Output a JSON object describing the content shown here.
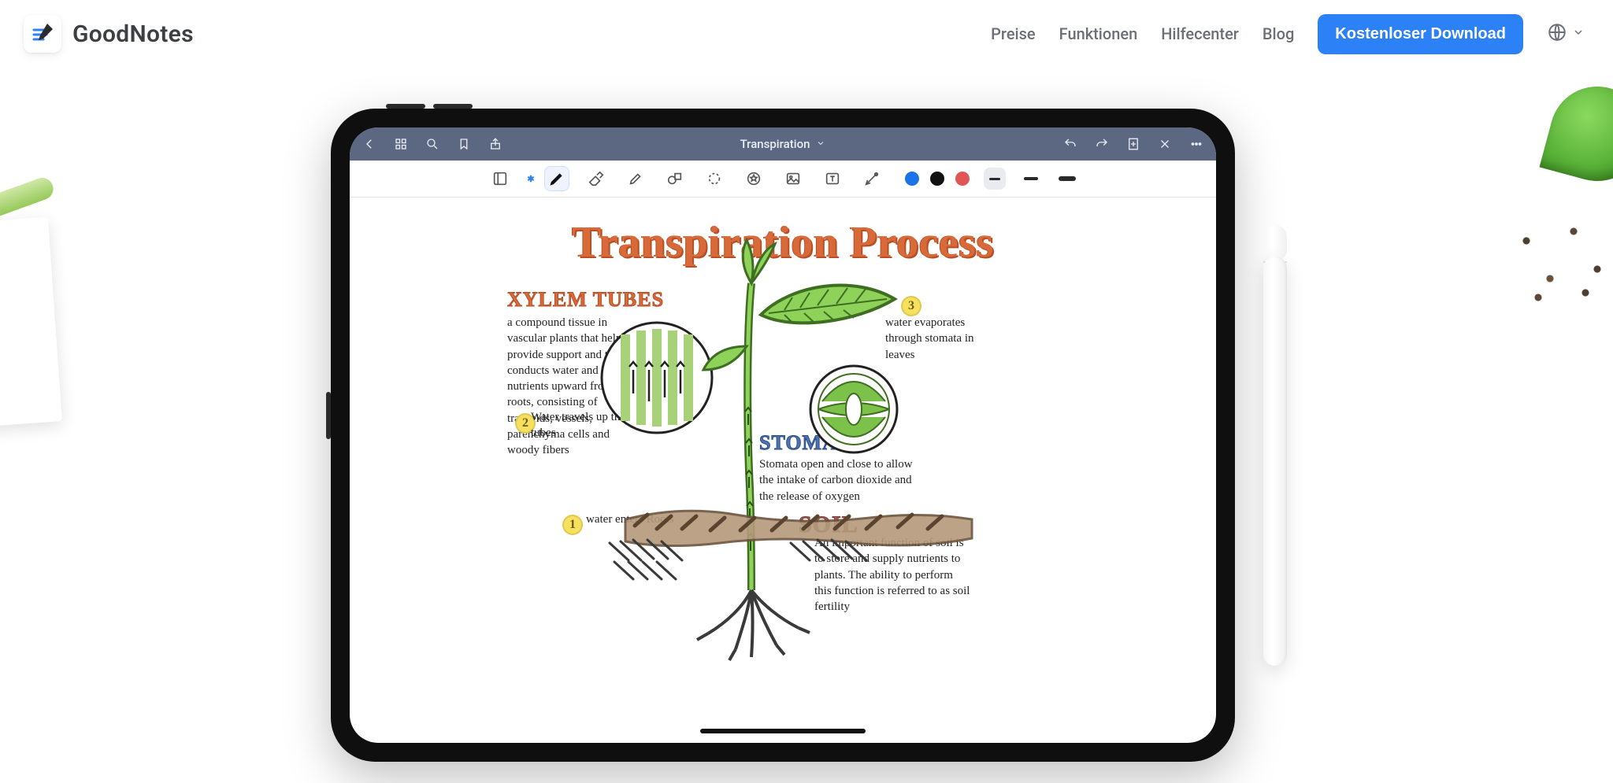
{
  "brand": {
    "name": "GoodNotes"
  },
  "nav": {
    "pricing": "Preise",
    "features": "Funktionen",
    "help": "Hilfecenter",
    "blog": "Blog",
    "cta": "Kostenloser Download"
  },
  "app": {
    "document_title": "Transpiration",
    "toolbar1": {
      "back": "back-icon",
      "thumbnails": "thumbnails-icon",
      "search": "search-icon",
      "bookmark": "bookmark-icon",
      "share": "share-icon",
      "undo": "undo-icon",
      "redo": "redo-icon",
      "add_page": "add-page-icon",
      "close": "close-icon",
      "more": "more-icon"
    },
    "toolbar2": {
      "tools": [
        "read-mode",
        "pen",
        "eraser",
        "highlighter",
        "shape",
        "lasso",
        "elements",
        "image",
        "text",
        "pointer"
      ],
      "selected_tool": "pen",
      "bluetooth_badge": "✱",
      "colors": {
        "blue": "#1a73e8",
        "black": "#111111",
        "red": "#e25555"
      },
      "selected_color": "black",
      "thicknesses": [
        "thin",
        "med",
        "thick"
      ],
      "selected_thickness": "thin"
    }
  },
  "note": {
    "title": "Transpiration Process",
    "sections": {
      "xylem": {
        "heading": "XYLEM TUBES",
        "body": "a compound tissue in vascular plants that helps provide support and that conducts water and nutrients upward from the roots, consisting of tracheids, vessels, parenchyma cells and woody fibers"
      },
      "stoma": {
        "heading": "STOMA",
        "body": "Stomata open and close to allow the intake of carbon dioxide and the release of oxygen"
      },
      "soil": {
        "heading": "SOIL",
        "body": "An important function of soil is to store and supply nutrients to plants. The ability to perform this function is referred to as soil fertility"
      }
    },
    "steps": {
      "s1": {
        "n": "1",
        "text": "water enters Roots"
      },
      "s2": {
        "n": "2",
        "text": "Water travels up through xylem tubes"
      },
      "s3": {
        "n": "3",
        "text": "water evaporates through stomata in leaves"
      }
    }
  }
}
